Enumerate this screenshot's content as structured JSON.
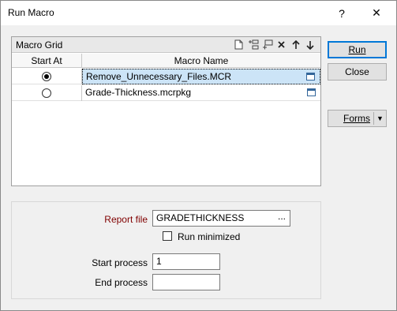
{
  "window": {
    "title": "Run Macro",
    "help_glyph": "?",
    "close_glyph": "✕"
  },
  "grid": {
    "title": "Macro Grid",
    "tools": [
      "new-icon",
      "insert-row-icon",
      "append-row-icon",
      "delete-icon",
      "move-up-icon",
      "move-down-icon"
    ],
    "columns": [
      "Start At",
      "Macro Name"
    ],
    "rows": [
      {
        "name": "Remove_Unnecessary_Files.MCR",
        "checked": true,
        "selected": true
      },
      {
        "name": "Grade-Thickness.mcrpkg",
        "checked": false,
        "selected": false
      }
    ]
  },
  "buttons": {
    "run": "Run",
    "close": "Close",
    "forms": "Forms",
    "forms_arrow": "▼"
  },
  "options": {
    "report_label": "Report file",
    "report_value": "GRADETHICKNESS",
    "browse_label": "...",
    "run_minimized_label": "Run minimized",
    "run_minimized_checked": false,
    "start_label": "Start process",
    "start_value": "1",
    "end_label": "End process",
    "end_value": ""
  },
  "colors": {
    "selection": "#cce4f7",
    "required_label": "#800000",
    "default_button_border": "#0078d7"
  }
}
